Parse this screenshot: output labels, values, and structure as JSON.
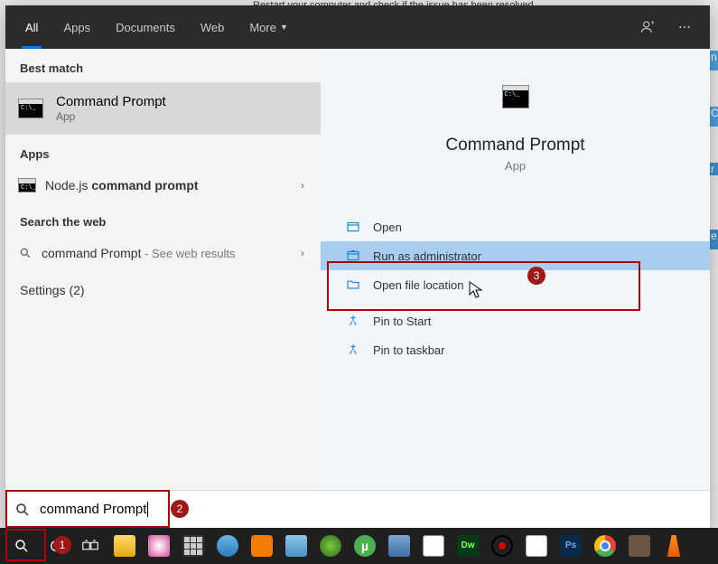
{
  "bg_text": "Restart your computer and check if the issue has been resolved",
  "tabs": {
    "all": "All",
    "apps": "Apps",
    "documents": "Documents",
    "web": "Web",
    "more": "More"
  },
  "left": {
    "best_match": "Best match",
    "best_title": "Command Prompt",
    "best_sub": "App",
    "apps_hdr": "Apps",
    "node_prefix": "Node.js ",
    "node_bold": "command prompt",
    "web_hdr": "Search the web",
    "web_query": "command Prompt",
    "web_suffix": " - See web results",
    "settings_hdr": "Settings (2)"
  },
  "right": {
    "title": "Command Prompt",
    "sub": "App",
    "open": "Open",
    "run_admin": "Run as administrator",
    "open_loc": "Open file location",
    "pin_start": "Pin to Start",
    "pin_taskbar": "Pin to taskbar"
  },
  "search_value": "command Prompt",
  "badges": {
    "b1": "1",
    "b2": "2",
    "b3": "3"
  }
}
